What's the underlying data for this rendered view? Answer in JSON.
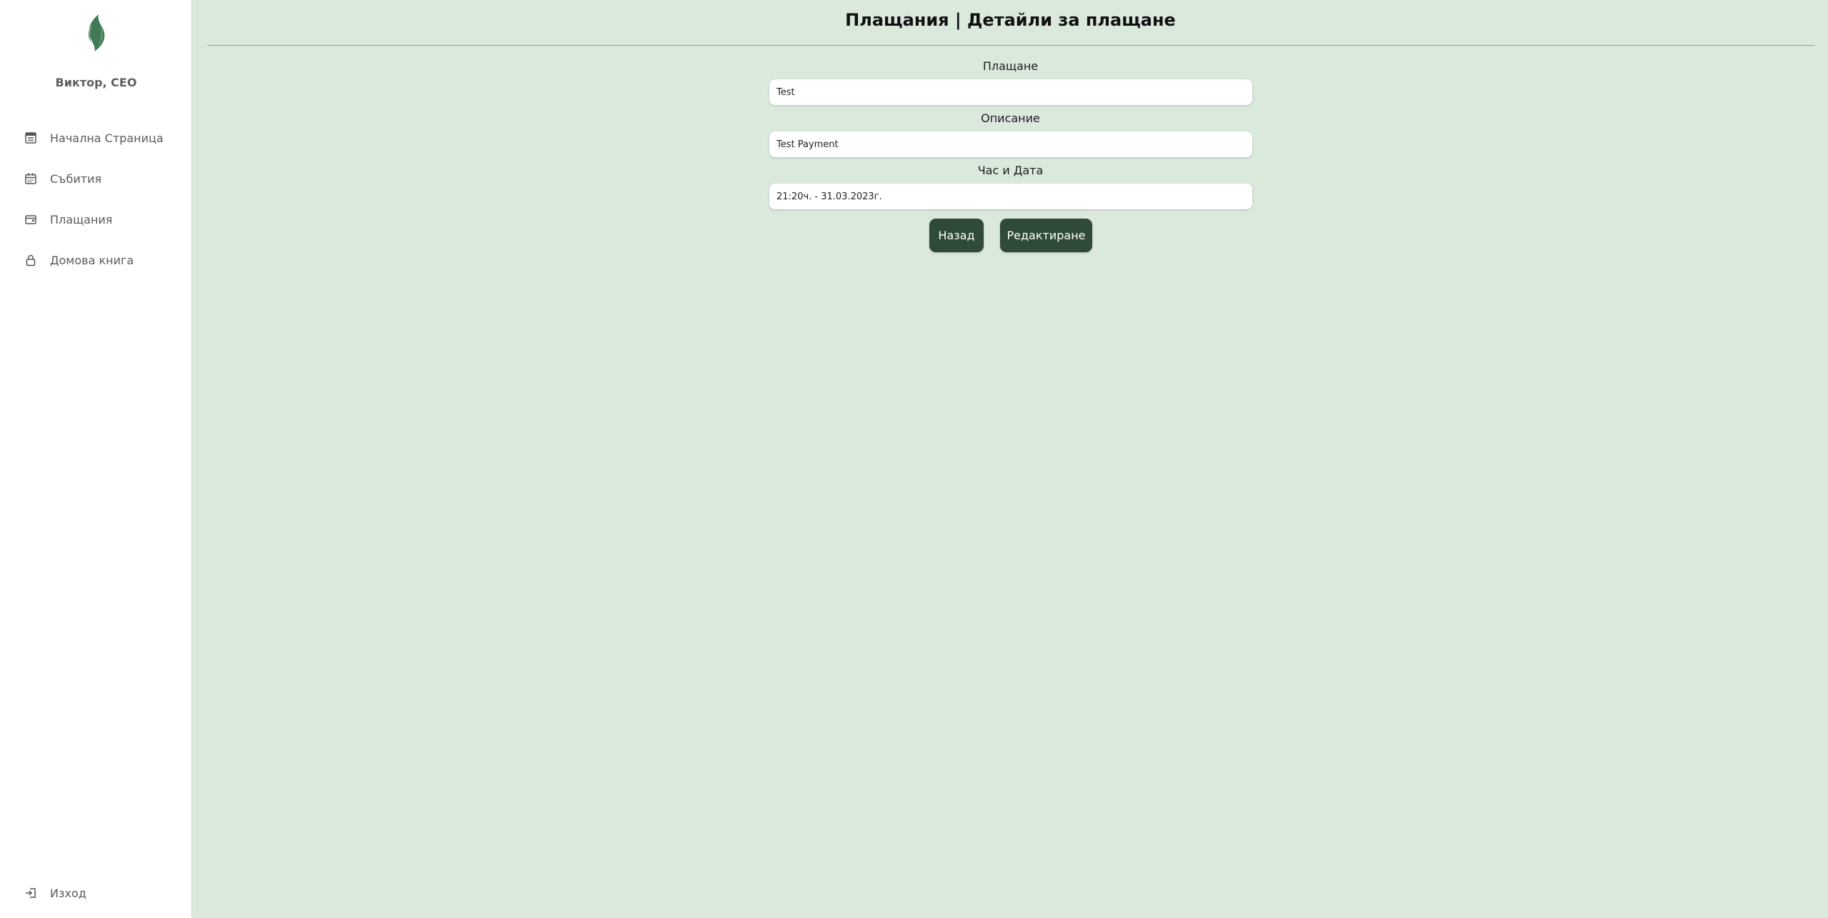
{
  "sidebar": {
    "user": "Виктор, CEO",
    "items": [
      {
        "label": "Начална Страница",
        "icon": "list-icon"
      },
      {
        "label": "Събития",
        "icon": "calendar-icon"
      },
      {
        "label": "Плащания",
        "icon": "wallet-icon"
      },
      {
        "label": "Домова книга",
        "icon": "lock-icon"
      }
    ],
    "logout": {
      "label": "Изход",
      "icon": "logout-icon"
    }
  },
  "page": {
    "title": "Плащания | Детайли за плащане"
  },
  "form": {
    "payment": {
      "label": "Плащане",
      "value": "Test"
    },
    "description": {
      "label": "Описание",
      "value": "Test Payment"
    },
    "datetime": {
      "label": "Час и Дата",
      "value": "21:20ч. - 31.03.2023г."
    }
  },
  "actions": {
    "back_label": "Назад",
    "edit_label": "Редактиране"
  },
  "colors": {
    "background": "#dbe9dd",
    "button": "#2f4a37",
    "logo": "#3f7a52"
  }
}
